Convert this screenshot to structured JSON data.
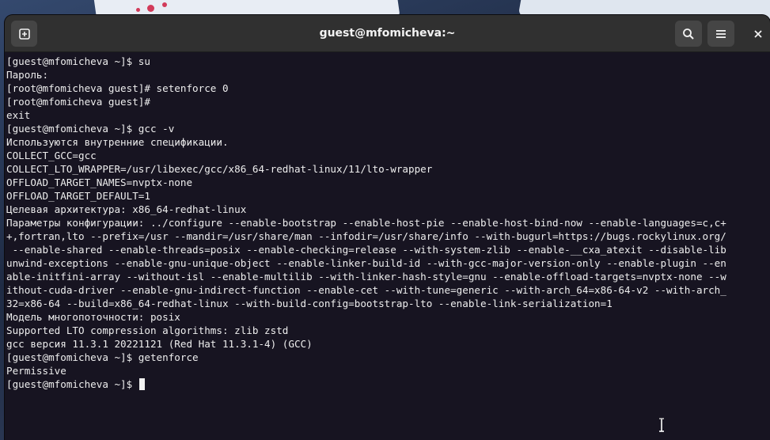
{
  "window": {
    "title": "guest@mfomicheva:~"
  },
  "icons": {
    "new_tab": "new-tab-icon",
    "search": "search-icon",
    "menu": "hamburger-menu-icon",
    "close": "close-icon",
    "cursor": "text-ibeam-cursor-icon"
  },
  "colors": {
    "terminal_bg": "#171421",
    "terminal_fg": "#eeeeee",
    "titlebar_bg": "#303030"
  },
  "terminal": {
    "lines": [
      "[guest@mfomicheva ~]$ su",
      "Пароль:",
      "[root@mfomicheva guest]# setenforce 0",
      "[root@mfomicheva guest]#",
      "exit",
      "[guest@mfomicheva ~]$ gcc -v",
      "Используются внутренние спецификации.",
      "COLLECT_GCC=gcc",
      "COLLECT_LTO_WRAPPER=/usr/libexec/gcc/x86_64-redhat-linux/11/lto-wrapper",
      "OFFLOAD_TARGET_NAMES=nvptx-none",
      "OFFLOAD_TARGET_DEFAULT=1",
      "Целевая архитектура: x86_64-redhat-linux",
      "Параметры конфигурации: ../configure --enable-bootstrap --enable-host-pie --enable-host-bind-now --enable-languages=c,c+",
      "+,fortran,lto --prefix=/usr --mandir=/usr/share/man --infodir=/usr/share/info --with-bugurl=https://bugs.rockylinux.org/",
      " --enable-shared --enable-threads=posix --enable-checking=release --with-system-zlib --enable-__cxa_atexit --disable-lib",
      "unwind-exceptions --enable-gnu-unique-object --enable-linker-build-id --with-gcc-major-version-only --enable-plugin --en",
      "able-initfini-array --without-isl --enable-multilib --with-linker-hash-style=gnu --enable-offload-targets=nvptx-none --w",
      "ithout-cuda-driver --enable-gnu-indirect-function --enable-cet --with-tune=generic --with-arch_64=x86-64-v2 --with-arch_",
      "32=x86-64 --build=x86_64-redhat-linux --with-build-config=bootstrap-lto --enable-link-serialization=1",
      "Модель многопоточности: posix",
      "Supported LTO compression algorithms: zlib zstd",
      "gcc версия 11.3.1 20221121 (Red Hat 11.3.1-4) (GCC)",
      "[guest@mfomicheva ~]$ getenforce",
      "Permissive",
      "[guest@mfomicheva ~]$ "
    ]
  }
}
